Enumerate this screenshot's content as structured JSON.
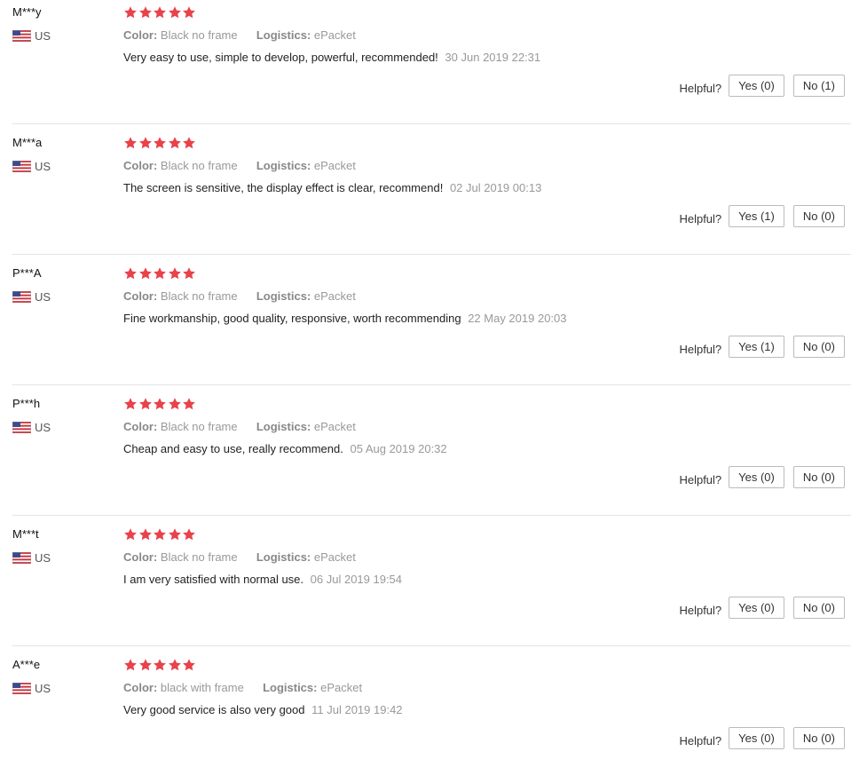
{
  "labels": {
    "color_key": "Color:",
    "logistics_key": "Logistics:",
    "helpful": "Helpful?"
  },
  "rating_color": "#e8424a",
  "reviews": [
    {
      "user": "M***y",
      "country": "US",
      "rating": 5,
      "color": "Black no frame",
      "logistics": "ePacket",
      "text": "Very easy to use, simple to develop, powerful, recommended!",
      "date": "30 Jun 2019 22:31",
      "yes": "Yes (0)",
      "no": "No (1)"
    },
    {
      "user": "M***a",
      "country": "US",
      "rating": 5,
      "color": "Black no frame",
      "logistics": "ePacket",
      "text": "The screen is sensitive, the display effect is clear, recommend!",
      "date": "02 Jul 2019 00:13",
      "yes": "Yes (1)",
      "no": "No (0)"
    },
    {
      "user": "P***A",
      "country": "US",
      "rating": 5,
      "color": "Black no frame",
      "logistics": "ePacket",
      "text": "Fine workmanship, good quality, responsive, worth recommending",
      "date": "22 May 2019 20:03",
      "yes": "Yes (1)",
      "no": "No (0)"
    },
    {
      "user": "P***h",
      "country": "US",
      "rating": 5,
      "color": "Black no frame",
      "logistics": "ePacket",
      "text": "Cheap and easy to use, really recommend.",
      "date": "05 Aug 2019 20:32",
      "yes": "Yes (0)",
      "no": "No (0)"
    },
    {
      "user": "M***t",
      "country": "US",
      "rating": 5,
      "color": "Black no frame",
      "logistics": "ePacket",
      "text": "I am very satisfied with normal use.",
      "date": "06 Jul 2019 19:54",
      "yes": "Yes (0)",
      "no": "No (0)"
    },
    {
      "user": "A***e",
      "country": "US",
      "rating": 5,
      "color": "black with frame",
      "logistics": "ePacket",
      "text": "Very good service is also very good",
      "date": "11 Jul 2019 19:42",
      "yes": "Yes (0)",
      "no": "No (0)"
    }
  ]
}
